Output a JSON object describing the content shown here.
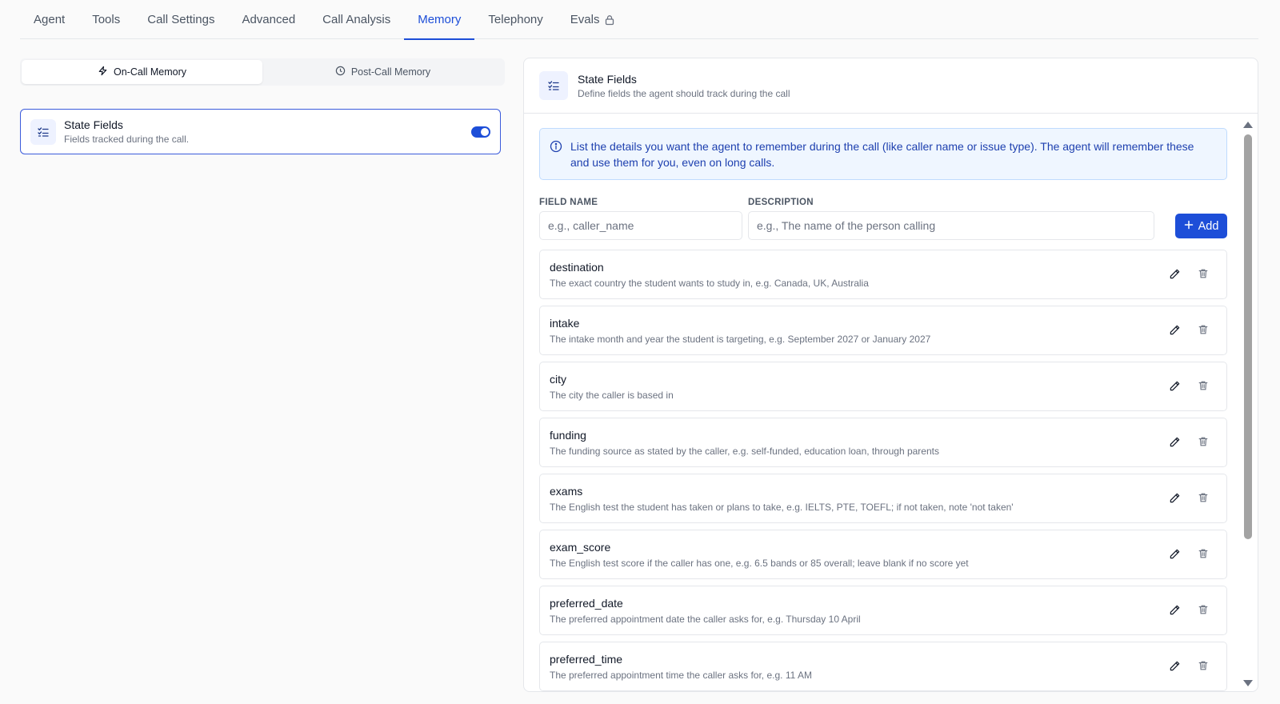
{
  "tabs": [
    {
      "label": "Agent"
    },
    {
      "label": "Tools"
    },
    {
      "label": "Call Settings"
    },
    {
      "label": "Advanced"
    },
    {
      "label": "Call Analysis"
    },
    {
      "label": "Memory",
      "active": true
    },
    {
      "label": "Telephony"
    },
    {
      "label": "Evals",
      "locked": true
    }
  ],
  "memory_mode": {
    "on_call": "On-Call Memory",
    "post_call": "Post-Call Memory",
    "selected": "On-Call Memory"
  },
  "left_card": {
    "title": "State Fields",
    "subtitle": "Fields tracked during the call.",
    "enabled": true
  },
  "panel": {
    "title": "State Fields",
    "subtitle": "Define fields the agent should track during the call",
    "info": "List the details you want the agent to remember during the call (like caller name or issue type). The agent will remember these and use them for you, even on long calls.",
    "field_name_label": "FIELD NAME",
    "field_name_placeholder": "e.g., caller_name",
    "description_label": "DESCRIPTION",
    "description_placeholder": "e.g., The name of the person calling",
    "add_label": "Add"
  },
  "fields": [
    {
      "name": "destination",
      "description": "The exact country the student wants to study in, e.g. Canada, UK, Australia"
    },
    {
      "name": "intake",
      "description": "The intake month and year the student is targeting, e.g. September 2027 or January 2027"
    },
    {
      "name": "city",
      "description": "The city the caller is based in"
    },
    {
      "name": "funding",
      "description": "The funding source as stated by the caller, e.g. self-funded, education loan, through parents"
    },
    {
      "name": "exams",
      "description": "The English test the student has taken or plans to take, e.g. IELTS, PTE, TOEFL; if not taken, note 'not taken'"
    },
    {
      "name": "exam_score",
      "description": "The English test score if the caller has one, e.g. 6.5 bands or 85 overall; leave blank if no score yet"
    },
    {
      "name": "preferred_date",
      "description": "The preferred appointment date the caller asks for, e.g. Thursday 10 April"
    },
    {
      "name": "preferred_time",
      "description": "The preferred appointment time the caller asks for, e.g. 11 AM"
    }
  ],
  "colors": {
    "accent": "#1d4ed8",
    "info_bg": "#eff6ff",
    "info_text": "#1e40af"
  }
}
